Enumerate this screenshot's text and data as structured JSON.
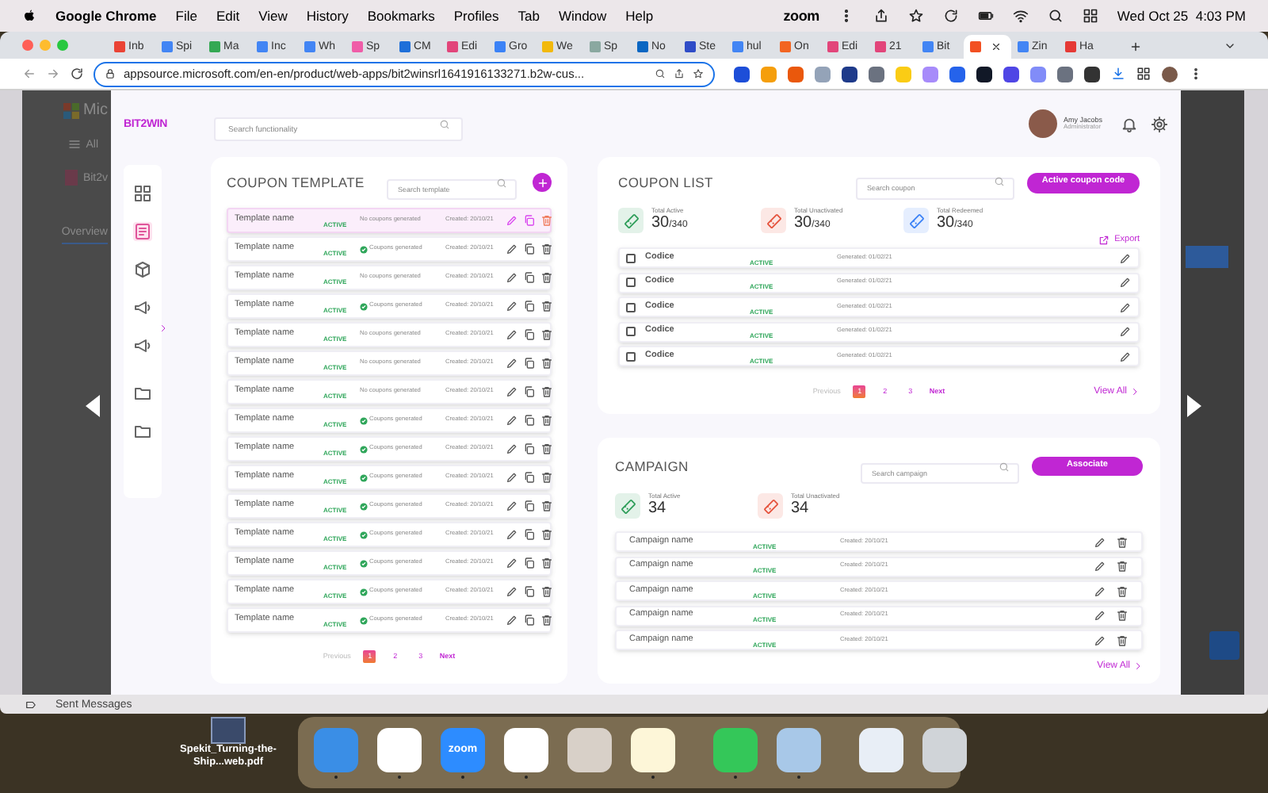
{
  "menu_bar": {
    "app": "Google Chrome",
    "menus": [
      "File",
      "Edit",
      "View",
      "History",
      "Bookmarks",
      "Profiles",
      "Tab",
      "Window",
      "Help"
    ],
    "status_text": "zoom",
    "clock": "Wed Oct 25  4:03 PM"
  },
  "browser": {
    "tabs": [
      {
        "label": "Inb",
        "color": "#ea4335",
        "selected": false
      },
      {
        "label": "Spi",
        "color": "#4285f4",
        "selected": false
      },
      {
        "label": "Ma",
        "color": "#34a853",
        "selected": false
      },
      {
        "label": "Inc",
        "color": "#4285f4",
        "selected": false
      },
      {
        "label": "Wh",
        "color": "#4285f4",
        "selected": false
      },
      {
        "label": "Sp",
        "color": "#ef5da8",
        "selected": false
      },
      {
        "label": "CM",
        "color": "#1e6fd9",
        "selected": false
      },
      {
        "label": "Edi",
        "color": "#e2457a",
        "selected": false
      },
      {
        "label": "Gro",
        "color": "#3b82f6",
        "selected": false
      },
      {
        "label": "We",
        "color": "#f2b90d",
        "selected": false
      },
      {
        "label": "Sp",
        "color": "#8aa8a0",
        "selected": false
      },
      {
        "label": "No",
        "color": "#0a66c2",
        "selected": false
      },
      {
        "label": "Ste",
        "color": "#2f4cc7",
        "selected": false
      },
      {
        "label": "hul",
        "color": "#4285f4",
        "selected": false
      },
      {
        "label": "On",
        "color": "#f26522",
        "selected": false
      },
      {
        "label": "Edi",
        "color": "#e2457a",
        "selected": false
      },
      {
        "label": "21",
        "color": "#e2457a",
        "selected": false
      },
      {
        "label": "Bit",
        "color": "#4285f4",
        "selected": false
      },
      {
        "color": "#f25022",
        "selected": true
      },
      {
        "label": "Zin",
        "color": "#4285f4",
        "selected": false
      },
      {
        "label": "Ha",
        "color": "#e53935",
        "selected": false
      }
    ],
    "url": "appsource.microsoft.com/en-en/product/web-apps/bit2winsrl1641916133271.b2w-cus..."
  },
  "background_page": {
    "brand": "Mic",
    "menu": "All",
    "app_name": "Bit2v",
    "tab": "Overview"
  },
  "app": {
    "logo": "BIT2WIN",
    "search_placeholder": "Search functionality",
    "user": {
      "name": "Amy Jacobs",
      "role": "Administrator"
    },
    "nav": [
      {
        "kind": "grid",
        "selected": false
      },
      {
        "kind": "coupon",
        "selected": true
      },
      {
        "kind": "box",
        "selected": false
      },
      {
        "kind": "megaphone",
        "selected": false
      },
      {
        "kind": "megaphone",
        "selected": false
      },
      {
        "kind": "folder",
        "selected": false
      },
      {
        "kind": "folder",
        "selected": false
      }
    ],
    "coupon_template": {
      "title": "COUPON TEMPLATE",
      "search_placeholder": "Search template",
      "rows": [
        {
          "name": "Template name",
          "status": "ACTIVE",
          "generated": false,
          "coupons": "No coupons generated",
          "created": "Created: 20/10/21",
          "selected": true
        },
        {
          "name": "Template name",
          "status": "ACTIVE",
          "generated": true,
          "coupons": "Coupons generated",
          "created": "Created: 20/10/21",
          "selected": false
        },
        {
          "name": "Template name",
          "status": "ACTIVE",
          "generated": false,
          "coupons": "No coupons generated",
          "created": "Created: 20/10/21",
          "selected": false
        },
        {
          "name": "Template name",
          "status": "ACTIVE",
          "generated": true,
          "coupons": "Coupons generated",
          "created": "Created: 20/10/21",
          "selected": false
        },
        {
          "name": "Template name",
          "status": "ACTIVE",
          "generated": false,
          "coupons": "No coupons generated",
          "created": "Created: 20/10/21",
          "selected": false
        },
        {
          "name": "Template name",
          "status": "ACTIVE",
          "generated": false,
          "coupons": "No coupons generated",
          "created": "Created: 20/10/21",
          "selected": false
        },
        {
          "name": "Template name",
          "status": "ACTIVE",
          "generated": false,
          "coupons": "No coupons generated",
          "created": "Created: 20/10/21",
          "selected": false
        },
        {
          "name": "Template name",
          "status": "ACTIVE",
          "generated": true,
          "coupons": "Coupons generated",
          "created": "Created: 20/10/21",
          "selected": false
        },
        {
          "name": "Template name",
          "status": "ACTIVE",
          "generated": true,
          "coupons": "Coupons generated",
          "created": "Created: 20/10/21",
          "selected": false
        },
        {
          "name": "Template name",
          "status": "ACTIVE",
          "generated": true,
          "coupons": "Coupons generated",
          "created": "Created: 20/10/21",
          "selected": false
        },
        {
          "name": "Template name",
          "status": "ACTIVE",
          "generated": true,
          "coupons": "Coupons generated",
          "created": "Created: 20/10/21",
          "selected": false
        },
        {
          "name": "Template name",
          "status": "ACTIVE",
          "generated": true,
          "coupons": "Coupons generated",
          "created": "Created: 20/10/21",
          "selected": false
        },
        {
          "name": "Template name",
          "status": "ACTIVE",
          "generated": true,
          "coupons": "Coupons generated",
          "created": "Created: 20/10/21",
          "selected": false
        },
        {
          "name": "Template name",
          "status": "ACTIVE",
          "generated": true,
          "coupons": "Coupons generated",
          "created": "Created: 20/10/21",
          "selected": false
        },
        {
          "name": "Template name",
          "status": "ACTIVE",
          "generated": true,
          "coupons": "Coupons generated",
          "created": "Created: 20/10/21",
          "selected": false
        }
      ],
      "pagination": {
        "previous": "Previous",
        "pages": [
          {
            "label": "1",
            "selected": true
          },
          {
            "label": "2",
            "selected": false
          },
          {
            "label": "3",
            "selected": false
          }
        ],
        "next": "Next"
      }
    },
    "coupon_list": {
      "title": "COUPON LIST",
      "search_placeholder": "Search coupon",
      "button": "Active coupon code",
      "stats": [
        {
          "label": "Total Active",
          "value": "30",
          "total": "/340",
          "color": "#2f9e5a"
        },
        {
          "label": "Total Unactivated",
          "value": "30",
          "total": "/340",
          "color": "#e5533d"
        },
        {
          "label": "Total Redeemed",
          "value": "30",
          "total": "/340",
          "color": "#3b82f6"
        }
      ],
      "export": "Export",
      "rows": [
        {
          "code": "Codice",
          "status": "ACTIVE",
          "generated": "Generated: 01/02/21",
          "checked": false
        },
        {
          "code": "Codice",
          "status": "ACTIVE",
          "generated": "Generated: 01/02/21",
          "checked": false
        },
        {
          "code": "Codice",
          "status": "ACTIVE",
          "generated": "Generated: 01/02/21",
          "checked": false
        },
        {
          "code": "Codice",
          "status": "ACTIVE",
          "generated": "Generated: 01/02/21",
          "checked": false
        },
        {
          "code": "Codice",
          "status": "ACTIVE",
          "generated": "Generated: 01/02/21",
          "checked": false
        }
      ],
      "pagination": {
        "previous": "Previous",
        "pages": [
          {
            "label": "1",
            "selected": true
          },
          {
            "label": "2",
            "selected": false
          },
          {
            "label": "3",
            "selected": false
          }
        ],
        "next": "Next"
      },
      "view_all": "View All"
    },
    "campaign": {
      "title": "CAMPAIGN",
      "search_placeholder": "Search campaign",
      "button": "Associate",
      "stats": [
        {
          "label": "Total Active",
          "value": "34",
          "color": "#2f9e5a"
        },
        {
          "label": "Total Unactivated",
          "value": "34",
          "color": "#e5533d"
        }
      ],
      "rows": [
        {
          "name": "Campaign name",
          "status": "ACTIVE",
          "created": "Created: 20/10/21"
        },
        {
          "name": "Campaign name",
          "status": "ACTIVE",
          "created": "Created: 20/10/21"
        },
        {
          "name": "Campaign name",
          "status": "ACTIVE",
          "created": "Created: 20/10/21"
        },
        {
          "name": "Campaign name",
          "status": "ACTIVE",
          "created": "Created: 20/10/21"
        },
        {
          "name": "Campaign name",
          "status": "ACTIVE",
          "created": "Created: 20/10/21"
        }
      ],
      "view_all": "View All"
    }
  },
  "sent_messages": "Sent Messages",
  "desktop_file": "Spekit_Turning-the-Ship...web.pdf",
  "dock": [
    {
      "kind": "finder",
      "running": true
    },
    {
      "kind": "chrome",
      "running": true
    },
    {
      "kind": "zoom",
      "label": "zoom",
      "running": true
    },
    {
      "kind": "slack",
      "running": true
    },
    {
      "kind": "launchpad",
      "running": false
    },
    {
      "kind": "notes",
      "running": true
    },
    {
      "kind": "messages",
      "running": true
    },
    {
      "kind": "preview",
      "running": true
    },
    {
      "kind": "screenshot",
      "running": false
    },
    {
      "kind": "trash",
      "running": false
    }
  ]
}
